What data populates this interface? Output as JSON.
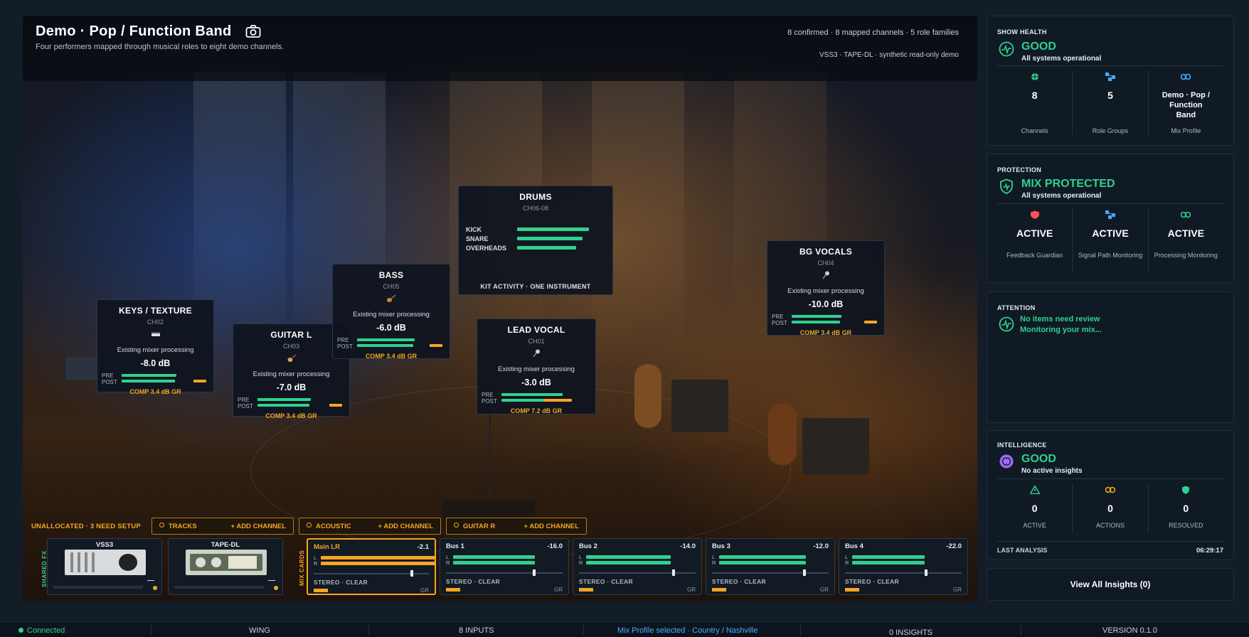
{
  "header": {
    "title": "Demo · Pop / Function Band",
    "subtitle": "Four performers mapped through musical roles to eight demo channels.",
    "stats": "8 confirmed · 8 mapped channels · 5 role families",
    "engine": "VSS3 · TAPE-DL · synthetic read-only demo"
  },
  "cards": [
    {
      "id": "keys",
      "name": "KEYS / TEXTURE",
      "channel": "CH02",
      "icon": "keyboard-icon",
      "processing": "Existing mixer processing",
      "db": "-8.0 dB",
      "pre": 0.7,
      "post": 0.68,
      "comp": "COMP 3.4 dB GR"
    },
    {
      "id": "guitar_l",
      "name": "GUITAR L",
      "channel": "CH03",
      "icon": "guitar-icon",
      "processing": "Existing mixer processing",
      "db": "-7.0 dB",
      "pre": 0.68,
      "post": 0.66,
      "comp": "COMP 3.4 dB GR"
    },
    {
      "id": "bass",
      "name": "BASS",
      "channel": "CH05",
      "icon": "bass-guitar-icon",
      "processing": "Existing mixer processing",
      "db": "-6.0 dB",
      "pre": 0.74,
      "post": 0.72,
      "comp": "COMP 3.4 dB GR"
    },
    {
      "id": "lead_vocal",
      "name": "LEAD VOCAL",
      "channel": "CH01",
      "icon": "microphone-icon",
      "processing": "Existing mixer processing",
      "db": "-3.0 dB",
      "pre": 0.78,
      "post": 0.9,
      "comp": "COMP 7.2 dB GR"
    },
    {
      "id": "bg_vocals",
      "name": "BG VOCALS",
      "channel": "CH04",
      "icon": "microphone-icon",
      "processing": "Existing mixer processing",
      "db": "-10.0 dB",
      "pre": 0.64,
      "post": 0.62,
      "comp": "COMP 3.4 dB GR"
    }
  ],
  "drums": {
    "name": "DRUMS",
    "channel": "CH06-08",
    "rows": [
      {
        "label": "KICK",
        "level": 0.88
      },
      {
        "label": "SNARE",
        "level": 0.8
      },
      {
        "label": "OVERHEADS",
        "level": 0.72
      }
    ],
    "footer": "KIT ACTIVITY · ONE INSTRUMENT"
  },
  "unallocated": "UNALLOCATED · 3 NEED SETUP",
  "slots": [
    {
      "label": "TRACKS",
      "action": "+ ADD CHANNEL"
    },
    {
      "label": "ACOUSTIC",
      "action": "+ ADD CHANNEL"
    },
    {
      "label": "GUITAR R",
      "action": "+ ADD CHANNEL"
    }
  ],
  "shared_fx_label": "SHARED FX",
  "mix_cards_label": "MIX CARDS",
  "fx": [
    {
      "name": "VSS3"
    },
    {
      "name": "TAPE-DL"
    }
  ],
  "buses": [
    {
      "name": "Main LR",
      "db": "-2.1",
      "l": 0.98,
      "r": 0.98,
      "fader": 0.85,
      "state": "STEREO · CLEAR",
      "gr": "GR",
      "active": true
    },
    {
      "name": "Bus 1",
      "db": "-16.0",
      "l": 0.7,
      "r": 0.7,
      "fader": 0.76,
      "state": "STEREO · CLEAR",
      "gr": "GR",
      "active": false
    },
    {
      "name": "Bus 2",
      "db": "-14.0",
      "l": 0.72,
      "r": 0.72,
      "fader": 0.82,
      "state": "STEREO · CLEAR",
      "gr": "GR",
      "active": false
    },
    {
      "name": "Bus 3",
      "db": "-12.0",
      "l": 0.74,
      "r": 0.74,
      "fader": 0.8,
      "state": "STEREO · CLEAR",
      "gr": "GR",
      "active": false
    },
    {
      "name": "Bus 4",
      "db": "-22.0",
      "l": 0.62,
      "r": 0.62,
      "fader": 0.7,
      "state": "STEREO · CLEAR",
      "gr": "GR",
      "active": false
    }
  ],
  "show_health": {
    "tag": "SHOW HEALTH",
    "status": "GOOD",
    "desc": "All systems operational",
    "cols": [
      {
        "icon": "channels-icon",
        "value": "8",
        "label": "Channels"
      },
      {
        "icon": "role-groups-icon",
        "value": "5",
        "label": "Role Groups"
      },
      {
        "icon": "mix-profile-icon",
        "value": "Demo · Pop / Function Band",
        "label": "Mix Profile"
      }
    ]
  },
  "protection": {
    "tag": "PROTECTION",
    "status": "MIX PROTECTED",
    "desc": "All systems operational",
    "cols": [
      {
        "icon": "feedback-guardian-icon",
        "value": "ACTIVE",
        "label": "Feedback Guardian",
        "color": "#ff4d5e"
      },
      {
        "icon": "signal-path-icon",
        "value": "ACTIVE",
        "label": "Signal Path Monitoring",
        "color": "#4aa8ff"
      },
      {
        "icon": "processing-icon",
        "value": "ACTIVE",
        "label": "Processing Monitoring",
        "color": "#2fd18e"
      }
    ]
  },
  "attention": {
    "tag": "ATTENTION",
    "line1": "No items need review",
    "line2": "Monitoring your mix..."
  },
  "intelligence": {
    "tag": "INTELLIGENCE",
    "status": "GOOD",
    "desc": "No active insights",
    "cols": [
      {
        "icon": "warning-icon",
        "value": "0",
        "label": "ACTIVE",
        "color": "#2fd18e"
      },
      {
        "icon": "actions-icon",
        "value": "0",
        "label": "ACTIONS",
        "color": "#f5a623"
      },
      {
        "icon": "resolved-icon",
        "value": "0",
        "label": "RESOLVED",
        "color": "#2fd18e"
      }
    ],
    "last_label": "LAST ANALYSIS",
    "last_time": "06:29:17"
  },
  "view_insights": "View All Insights (0)",
  "statusbar": {
    "connected": "Connected",
    "console": "WING",
    "inputs": "8 INPUTS",
    "profile": "Mix Profile selected · Country / Nashville",
    "insights": "0 INSIGHTS",
    "version": "VERSION 0.1.0"
  },
  "colors": {
    "accent_green": "#2fd18e",
    "accent_orange": "#f5a623",
    "accent_blue": "#4aa8ff",
    "danger": "#ff4d5e",
    "purple": "#a068ff"
  }
}
